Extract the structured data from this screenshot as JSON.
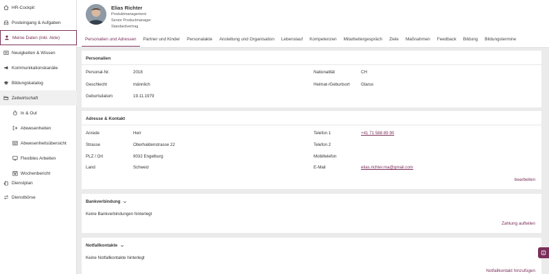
{
  "sidebar": {
    "items": [
      {
        "label": "HR-Cockpit",
        "icon": "home-icon"
      },
      {
        "label": "Posteingang & Aufgaben",
        "icon": "inbox-icon"
      },
      {
        "label": "Meine Daten (inkl. Akte)",
        "icon": "person-icon"
      },
      {
        "label": "Neuigkeiten & Wissen",
        "icon": "news-icon"
      },
      {
        "label": "Kommunikationskanäle",
        "icon": "megaphone-icon"
      },
      {
        "label": "Bildungskatalog",
        "icon": "graduation-cap-icon"
      },
      {
        "label": "Zeitwirtschaft",
        "icon": "folder-open-icon"
      },
      {
        "label": "In & Out",
        "icon": "stopwatch-icon"
      },
      {
        "label": "Abwesenheiten",
        "icon": "exit-icon"
      },
      {
        "label": "Abwesenheitsübersicht",
        "icon": "calendar-grid-icon"
      },
      {
        "label": "Flexibles Arbeiten",
        "icon": "monitor-icon"
      },
      {
        "label": "Wochenbericht",
        "icon": "calendar-icon"
      },
      {
        "label": "Dienstplan",
        "icon": "hand-icon"
      },
      {
        "label": "Dienstbörse",
        "icon": "swap-icon"
      }
    ]
  },
  "profile": {
    "name": "Elias Richter",
    "line1": "Produktmanagement",
    "line2": "Senior Productmanager",
    "line3": "Standardvertrag"
  },
  "tabs": [
    "Personalien und Adressen",
    "Partner und Kinder",
    "Personalakte",
    "Anstellung und Organisation",
    "Lebenslauf",
    "Kompetenzen",
    "Mitarbeitergespräch",
    "Ziele",
    "Maßnahmen",
    "Feedback",
    "Bildung",
    "Bildungstermine"
  ],
  "personalien": {
    "title": "Personalien",
    "personal_nr_label": "Personal-Nr.",
    "personal_nr": "2018",
    "geschlecht_label": "Geschlecht",
    "geschlecht": "männlich",
    "geburtsdatum_label": "Geburtsdatum",
    "geburtsdatum": "19.11.1979",
    "nationalitaet_label": "Nationalität",
    "nationalitaet": "CH",
    "heimat_label": "Heimat-/Geburtsort",
    "heimat": "Glarus"
  },
  "adresse": {
    "title": "Adresse & Kontakt",
    "anrede_label": "Anrede",
    "anrede": "Herr",
    "strasse_label": "Strasse",
    "strasse": "Oberhaldenstrasse 22",
    "plz_label": "PLZ / Ort",
    "plz": "9032 Engelburg",
    "land_label": "Land",
    "land": "Schweiz",
    "tel1_label": "Telefon 1",
    "tel1": "+41 71 588 89 90",
    "tel2_label": "Telefon 2",
    "mobil_label": "Mobiltelefon",
    "email_label": "E-Mail",
    "email": "elias.richter.ma@gmail.com",
    "edit": "bearbeiten"
  },
  "bank": {
    "title": "Bankverbindung",
    "empty": "Keine Bankverbindungen hinterlegt",
    "action": "Zahlung aufteilen"
  },
  "notfall": {
    "title": "Notfallkontakte",
    "empty": "Keine Notfallkontakte hinterlegt",
    "action": "Notfallkontakt hinzufügen"
  },
  "colors": {
    "accent": "#7a2e58",
    "background": "#ebebeb"
  }
}
